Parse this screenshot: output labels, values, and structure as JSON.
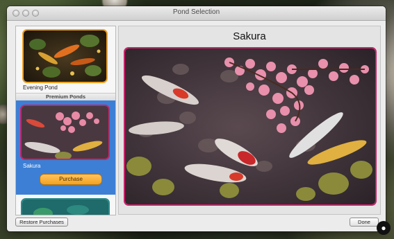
{
  "window": {
    "title": "Pond Selection"
  },
  "sidebar": {
    "items": [
      {
        "label": "Evening Pond"
      },
      {
        "label": "Sakura",
        "button": "Purchase"
      }
    ],
    "section_header": "Premium Ponds"
  },
  "detail": {
    "title": "Sakura"
  },
  "footer": {
    "restore_label": "Restore Purchases",
    "done_label": "Done"
  },
  "colors": {
    "accent": "#3d7fd5",
    "purchase": "#f4a21e",
    "frame": "#c8246a",
    "selected_frame": "#c8246a"
  }
}
